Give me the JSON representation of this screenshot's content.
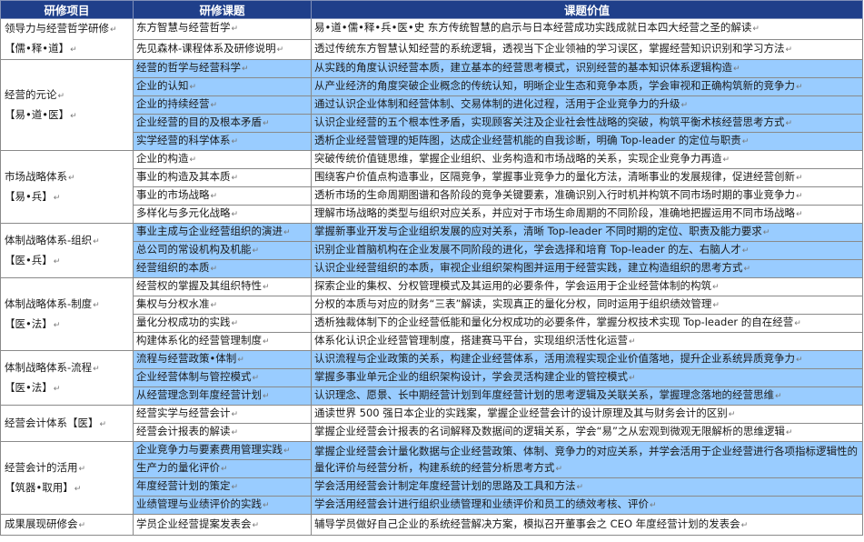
{
  "headers": {
    "module": "研修项目",
    "topic": "研修课题",
    "value": "课题价值"
  },
  "mark": "↵",
  "groups": [
    {
      "module_lines": [
        "领导力与经营哲学研修",
        "【儒•释•道】"
      ],
      "rows": [
        {
          "topic": "东方智慧与经营哲学",
          "value": "易•道•儒•释•兵•医•史 东方传统智慧的启示与日本经营成功实践成就日本四大经营之圣的解读",
          "shade": "white"
        },
        {
          "topic": "先见森林-课程体系及研修说明",
          "value": "透过传统东方智慧认知经营的系统逻辑，透视当下企业领袖的学习误区，掌握经营知识识别和学习方法",
          "shade": "white"
        }
      ]
    },
    {
      "module_lines": [
        "经营的元论",
        "【易•道•医】"
      ],
      "rows": [
        {
          "topic": "经营的哲学与经营科学",
          "value": "从实践的角度认识经营本质，建立基本的经营思考模式，识别经营的基本知识体系逻辑构造",
          "shade": "blue"
        },
        {
          "topic": "企业的认知",
          "value": "从产业经济的角度突破企业概念的传统认知，明晰企业生态和竞争本质，学会审视和正确构筑新的竞争力",
          "shade": "blue"
        },
        {
          "topic": "企业的持续经营",
          "value": "通过认识企业体制和经营体制、交易体制的进化过程，活用于企业竞争力的升级",
          "shade": "blue"
        },
        {
          "topic": "企业经营的目的及根本矛盾",
          "value": "认识企业经营的五个根本性矛盾，实现顾客关注及企业社会性战略的突破，构筑平衡术核经营思考方式",
          "shade": "blue"
        },
        {
          "topic": "实学经营的科学体系",
          "value": "透析企业经营管理的矩阵图，达成企业经营机能的自我诊断，明确 Top-leader 的定位与职责",
          "shade": "blue"
        }
      ]
    },
    {
      "module_lines": [
        "市场战略体系",
        "【易•兵】"
      ],
      "rows": [
        {
          "topic": "企业的构造",
          "value": "突破传统价值链思维，掌握企业组织、业务构造和市场战略的关系，实现企业竞争力再造",
          "shade": "white"
        },
        {
          "topic": "事业的构造及其本质",
          "value": "围绕客户价值点构造事业，区隔竞争，掌握事业竞争力的量化方法，清晰事业的发展规律，促进经营创新",
          "shade": "white"
        },
        {
          "topic": "事业的市场战略",
          "value": "透析市场的生命周期图谱和各阶段的竞争关键要素，准确识别入行时机并构筑不同市场时期的事业竞争力",
          "shade": "white"
        },
        {
          "topic": "多样化与多元化战略",
          "value": "理解市场战略的类型与组织对应关系，并应对于市场生命周期的不同阶段，准确地把握运用不同市场战略",
          "shade": "white"
        }
      ]
    },
    {
      "module_lines": [
        "体制战略体系-组织",
        "【医•兵】"
      ],
      "rows": [
        {
          "topic": "事业主成与企业经营组织的演进",
          "value": "掌握新事业开发与企业组织发展的应对关系，清晰 Top-leader 不同时期的定位、职责及能力要求",
          "shade": "blue"
        },
        {
          "topic": "总公司的常设机构及机能",
          "value": "识别企业首脑机构在企业发展不同阶段的进化，学会选择和培育 Top-leader 的左、右脑人才",
          "shade": "blue"
        },
        {
          "topic": "经营组织的本质",
          "value": "认识企业经营组织的本质，审视企业组织架构图并运用于经营实践，建立构造组织的思考方式",
          "shade": "blue"
        }
      ]
    },
    {
      "module_lines": [
        "体制战略体系-制度",
        "【医•法】"
      ],
      "rows": [
        {
          "topic": "经营权的掌握及其组织特性",
          "value": "探索企业的集权、分权管理模式及其运用的必要条件，学会运用于企业经营体制的构筑",
          "shade": "white"
        },
        {
          "topic": "集权与分权水准",
          "value": "分权的本质与对应的财务“三表”解读，实现真正的量化分权，同时运用于组织绩效管理",
          "shade": "white"
        },
        {
          "topic": "量化分权成功的实践",
          "value": "透析独裁体制下的企业经营低能和量化分权成功的必要条件，掌握分权技术实现 Top-leader 的自在经营",
          "shade": "white"
        },
        {
          "topic": "构建体系化的经营管理制度",
          "value": "体系化认识企业经营管理制度，搭建赛马平台，实现组织活性化运营",
          "shade": "white"
        }
      ]
    },
    {
      "module_lines": [
        "体制战略体系-流程",
        "【医•法】"
      ],
      "rows": [
        {
          "topic": "流程与经营政策•体制",
          "value": "认识流程与企业政策的关系，构建企业经营体系，活用流程实现企业价值落地，提升企业系统异质竞争力",
          "shade": "blue"
        },
        {
          "topic": "企业经营体制与管控模式",
          "value": "掌握多事业单元企业的组织架构设计，学会灵活构建企业的管控模式",
          "shade": "blue"
        },
        {
          "topic": "从经营理念到年度经营计划",
          "value": "认识理念、愿景、长中期经营计划到年度经营计划的思考逻辑及关联关系，掌握理念落地的经营思维",
          "shade": "blue"
        }
      ]
    },
    {
      "module_lines": [
        "经营会计体系【医】"
      ],
      "rows": [
        {
          "topic": "经营实学与经营会计",
          "value": "通读世界 500 强日本企业的实践案，掌握企业经营会计的设计原理及其与财务会计的区别",
          "shade": "white"
        },
        {
          "topic": "经营会计报表的解读",
          "value": "掌握企业经营会计报表的名词解释及数据间的逻辑关系，学会“易”之从宏观到微观无限解析的思维逻辑",
          "shade": "white"
        }
      ]
    },
    {
      "module_lines": [
        "经营会计的活用",
        "【筑器•取用】"
      ],
      "rows": [
        {
          "topic": "企业竞争力与要素费用管理实践",
          "topic2": "生产力的量化评价",
          "value": "掌握企业经营会计量化数据与企业经营政策、体制、竞争力的对应关系，并学会活用于企业经营进行各项指标逻辑性的量化评价与经营分析，构建系统的经营分析思考方式",
          "shade": "blue"
        },
        {
          "topic": "年度经营计划的策定",
          "value": "学会活用经营会计制定年度经营计划的思路及工具和方法",
          "shade": "blue"
        },
        {
          "topic": "业绩管理与业绩评价的实践",
          "value": "学会活用经营会计进行组织业绩管理和业绩评价和员工的绩效考核、评价",
          "shade": "blue"
        }
      ]
    },
    {
      "module_lines": [
        "成果展现研修会"
      ],
      "rows": [
        {
          "topic": "学员企业经营提案发表会",
          "value": "辅导学员做好自己企业的系统经营解决方案，模拟召开董事会之 CEO 年度经营计划的发表会",
          "shade": "white"
        }
      ]
    }
  ]
}
